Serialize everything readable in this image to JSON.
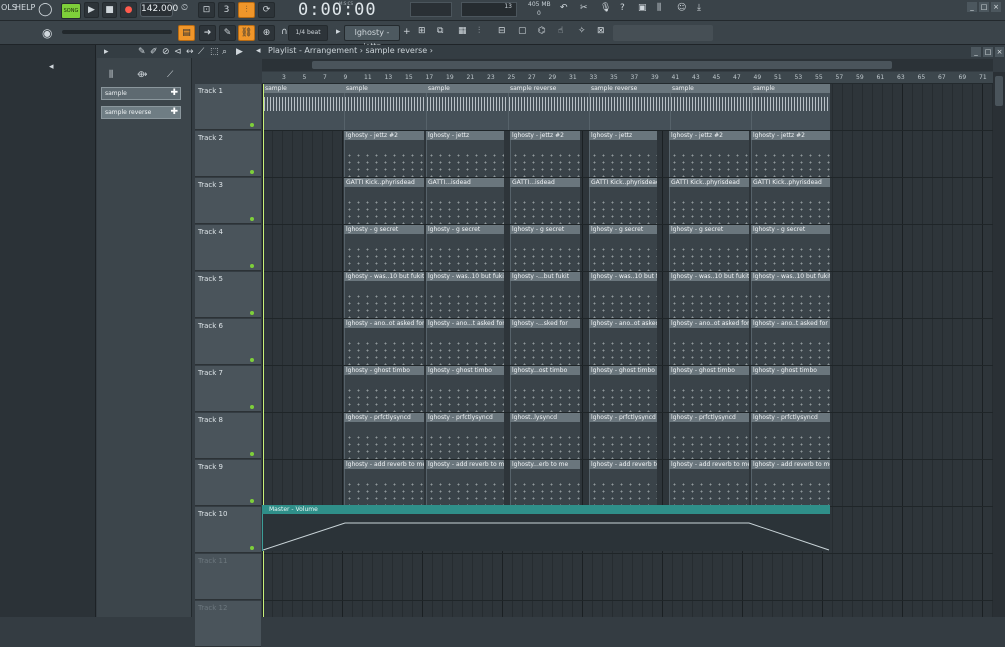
{
  "menu": {
    "tools": "OLS",
    "help": "HELP"
  },
  "transport": {
    "mode": "SONG",
    "tempo": "142.000",
    "time": "0:00:00",
    "time_unit": "M:S:CS"
  },
  "stats": {
    "cpu": "13",
    "mem": "405 MB",
    "mem2": "0"
  },
  "snap": {
    "value": "1/4 beat"
  },
  "pattern": {
    "value": "lghosty - jettz"
  },
  "breadcrumb": {
    "a": "Playlist",
    "b": "Arrangement",
    "c": "sample reverse"
  },
  "picker": {
    "items": [
      "sample",
      "sample reverse"
    ]
  },
  "ruler_labels": [
    "3",
    "5",
    "7",
    "9",
    "11",
    "13",
    "15",
    "17",
    "19",
    "21",
    "23",
    "25",
    "27",
    "29",
    "31",
    "33",
    "35",
    "37",
    "39",
    "41",
    "43",
    "45",
    "47",
    "49",
    "51",
    "53",
    "55",
    "57",
    "59",
    "61",
    "63",
    "65",
    "67",
    "69",
    "71"
  ],
  "tracks": [
    "Track 1",
    "Track 2",
    "Track 3",
    "Track 4",
    "Track 5",
    "Track 6",
    "Track 7",
    "Track 8",
    "Track 9",
    "Track 10",
    "Track 11",
    "Track 12"
  ],
  "clips": {
    "t1": [
      "sample",
      "sample",
      "sample",
      "sample reverse",
      "sample reverse",
      "sample",
      "sample"
    ],
    "t2": [
      "lghosty - jettz #2",
      "lghosty - jettz",
      "lghosty - jettz #2",
      "lghosty - jettz",
      "lghosty - jettz #2",
      "lghosty - jettz #2"
    ],
    "t3": [
      "GATTI Kick..phyrisdead",
      "GATTI...isdead",
      "GATTI...isdead",
      "GATTI Kick..phyrisdead",
      "GATTI Kick..phyrisdead",
      "GATTI Kick..phyrisdead"
    ],
    "t4": [
      "lghosty - g secret",
      "lghosty - g secret",
      "lghosty - g secret",
      "lghosty - g secret",
      "lghosty - g secret",
      "lghosty - g secret"
    ],
    "t5": [
      "lghosty - was..10 but fukit",
      "lghosty - was..10 but fukit",
      "lghosty -...but fukit",
      "lghosty - was..10 but fukit",
      "lghosty - was..10 but fukit",
      "lghosty - was..10 but fukit"
    ],
    "t6": [
      "lghosty - ano..ot asked for",
      "lghosty - ano...t asked for",
      "lghosty -...sked for",
      "lghosty - ano..ot asked for",
      "lghosty - ano..ot asked for",
      "lghosty - ano..t asked for"
    ],
    "t7": [
      "lghosty - ghost timbo",
      "lghosty - ghost timbo",
      "lghosty...ost timbo",
      "lghosty - ghost timbo",
      "lghosty - ghost timbo",
      "lghosty - ghost timbo"
    ],
    "t8": [
      "lghosty - prfctlysyncd",
      "lghosty - prfctlysyncd",
      "lghost..lysyncd",
      "lghosty - prfctlysyncd",
      "lghosty - prfctlysyncd",
      "lghosty - prfctlysyncd"
    ],
    "t9": [
      "lghosty - add reverb to me",
      "lghosty - add reverb to me",
      "lghosty...erb to me",
      "lghosty - add reverb to me",
      "lghosty - add reverb to me",
      "lghosty - add reverb to me"
    ]
  },
  "automation": {
    "label": "Master - Volume"
  },
  "colors": {
    "accent": "#f0962a",
    "led": "#7ecf3a",
    "automation": "#2f8f89"
  }
}
